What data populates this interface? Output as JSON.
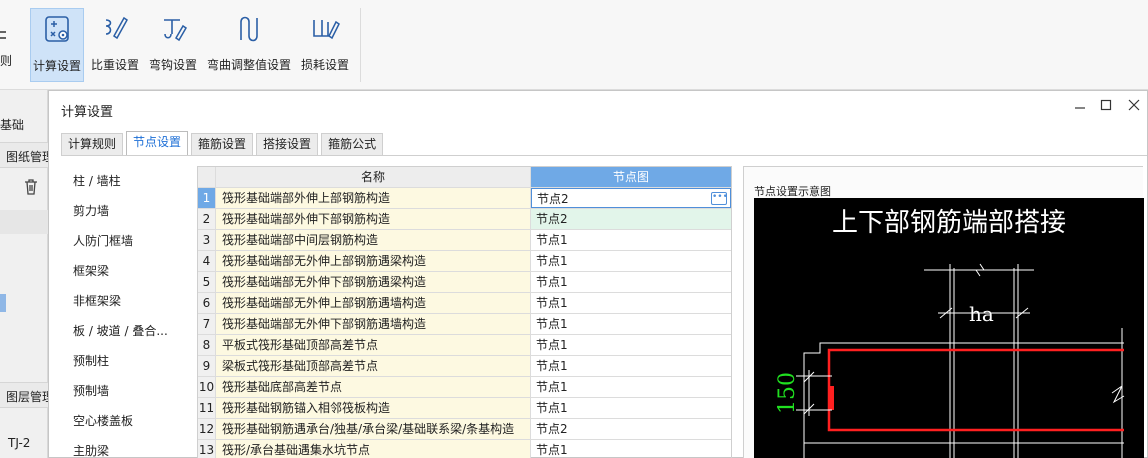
{
  "ribbon": {
    "partial_label": "则",
    "buttons": [
      {
        "label": "计算设置",
        "icon": "calc-settings-icon",
        "active": true
      },
      {
        "label": "比重设置",
        "icon": "density-settings-icon"
      },
      {
        "label": "弯钩设置",
        "icon": "hook-settings-icon"
      },
      {
        "label": "弯曲调整值设置",
        "icon": "bend-adjust-icon"
      },
      {
        "label": "损耗设置",
        "icon": "loss-settings-icon"
      }
    ]
  },
  "left_panel": {
    "title": "基础",
    "section1": "图纸管理",
    "section2": "图层管理",
    "item": "TJ-2"
  },
  "dialog": {
    "title": "计算设置",
    "tabs": [
      "计算规则",
      "节点设置",
      "箍筋设置",
      "搭接设置",
      "箍筋公式"
    ],
    "active_tab": 1,
    "categories": [
      "柱 / 墙柱",
      "剪力墙",
      "人防门框墙",
      "框架梁",
      "非框架梁",
      "板 / 坡道 / 叠合...",
      "预制柱",
      "预制墙",
      "空心楼盖板",
      "主肋梁"
    ],
    "grid": {
      "col_name": "名称",
      "col_node": "节点图",
      "rows": [
        {
          "n": "1",
          "name": "筏形基础端部外伸上部钢筋构造",
          "node": "节点2"
        },
        {
          "n": "2",
          "name": "筏形基础端部外伸下部钢筋构造",
          "node": "节点2"
        },
        {
          "n": "3",
          "name": "筏形基础端部中间层钢筋构造",
          "node": "节点1"
        },
        {
          "n": "4",
          "name": "筏形基础端部无外伸上部钢筋遇梁构造",
          "node": "节点1"
        },
        {
          "n": "5",
          "name": "筏形基础端部无外伸下部钢筋遇梁构造",
          "node": "节点1"
        },
        {
          "n": "6",
          "name": "筏形基础端部无外伸上部钢筋遇墙构造",
          "node": "节点1"
        },
        {
          "n": "7",
          "name": "筏形基础端部无外伸下部钢筋遇墙构造",
          "node": "节点1"
        },
        {
          "n": "8",
          "name": "平板式筏形基础顶部高差节点",
          "node": "节点1"
        },
        {
          "n": "9",
          "name": "梁板式筏形基础顶部高差节点",
          "node": "节点1"
        },
        {
          "n": "10",
          "name": "筏形基础底部高差节点",
          "node": "节点1"
        },
        {
          "n": "11",
          "name": "筏形基础钢筋锚入相邻筏板构造",
          "node": "节点1"
        },
        {
          "n": "12",
          "name": "筏形基础钢筋遇承台/独基/承台梁/基础联系梁/条基构造",
          "node": "节点2"
        },
        {
          "n": "13",
          "name": "筏形/承台基础遇集水坑节点",
          "node": "节点1"
        }
      ]
    },
    "preview": {
      "label": "节点设置示意图",
      "heading": "上下部钢筋端部搭接",
      "dim_ha": "ha",
      "dim_150": "150",
      "colors": {
        "bg": "#000000",
        "line": "#ffffff",
        "rebar": "#ff2020",
        "dim": "#20e020"
      }
    }
  }
}
